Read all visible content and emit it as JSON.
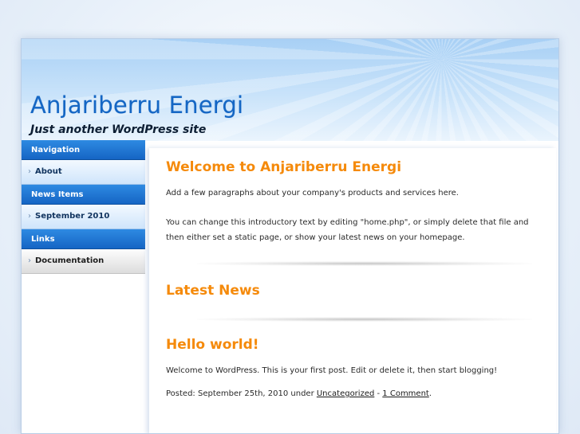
{
  "site": {
    "title": "Anjariberru Energi",
    "tagline": "Just another WordPress site"
  },
  "sidebar": {
    "sections": [
      {
        "heading": "Navigation",
        "items": [
          {
            "label": "About",
            "style": "blue"
          }
        ]
      },
      {
        "heading": "News Items",
        "items": [
          {
            "label": "September 2010",
            "style": "blue"
          }
        ]
      },
      {
        "heading": "Links",
        "items": [
          {
            "label": "Documentation",
            "style": "grey"
          }
        ]
      }
    ]
  },
  "main": {
    "welcome": {
      "heading": "Welcome to Anjariberru Energi",
      "para1": "Add a few paragraphs about your company's products and services here.",
      "para2": "You can change this introductory text by editing \"home.php\", or simply delete that file and then either set a static page, or show your latest news on your homepage."
    },
    "latest_news": {
      "heading": "Latest News"
    },
    "post": {
      "title": "Hello world!",
      "body": "Welcome to WordPress. This is your first post. Edit or delete it, then start blogging!",
      "meta_prefix": "Posted: September 25th, 2010 under ",
      "category": "Uncategorized",
      "meta_sep": " - ",
      "comments": "1 Comment",
      "meta_suffix": "."
    }
  },
  "colors": {
    "title": "#1466c4",
    "heading": "#f58a0b",
    "nav_head": "#1565c4"
  }
}
